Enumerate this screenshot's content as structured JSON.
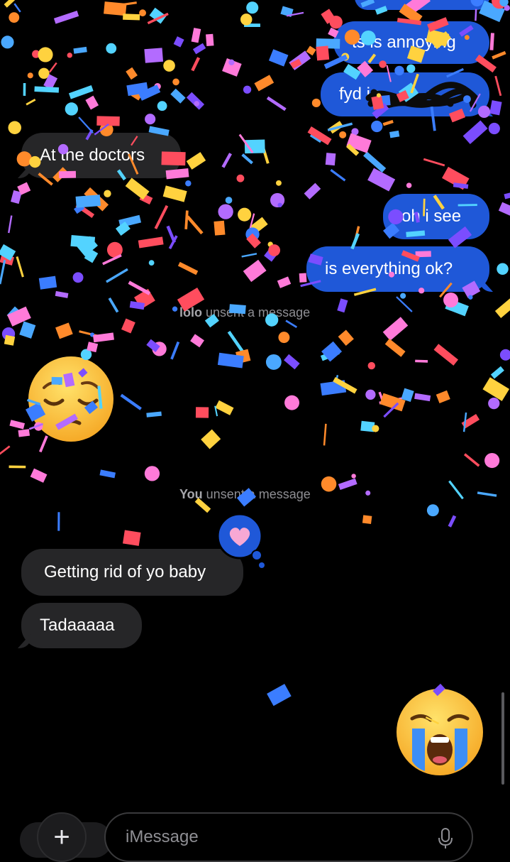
{
  "messages": {
    "sent_top": "",
    "sent_annoying": "ts is annoying",
    "sent_fyd": "fyd in",
    "recv_doctors": "At the doctors",
    "sent_oh": "oh i see",
    "sent_everything": "is everything ok?",
    "recv_baby": "Getting rid of yo baby",
    "recv_tada": "Tadaaaaa"
  },
  "system": {
    "unsent1_name": "lolo",
    "unsent1_text": " unsent a message",
    "unsent2_name": "You",
    "unsent2_text": " unsent a message"
  },
  "emoji": {
    "pensive": "pensive-face",
    "crying": "loudly-crying-face",
    "tapback": "pink-heart"
  },
  "composer": {
    "placeholder": "iMessage",
    "add_label": "+",
    "mic_icon": "microphone-icon"
  },
  "colors": {
    "sent_bubble": "#1f58d8",
    "received_bubble": "#262628",
    "background": "#000000"
  },
  "effect": "confetti"
}
